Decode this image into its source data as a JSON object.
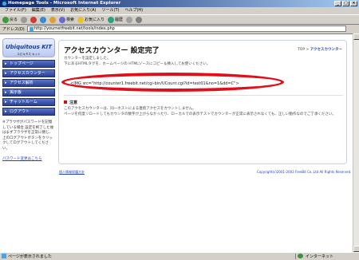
{
  "window": {
    "title": "Homepage Tools - Microsoft Internet Explorer"
  },
  "menu": [
    "ファイル(F)",
    "編集(E)",
    "表示(V)",
    "お気に入り(A)",
    "ツール(T)",
    "ヘルプ(H)"
  ],
  "toolbar": {
    "back": "戻る",
    "search": "検索",
    "favorites": "お気に入り",
    "history": "履歴"
  },
  "address": {
    "label": "アドレス(D)",
    "url": "http://yournetfreebit.net/tools/index.php"
  },
  "status": {
    "left": "ページが表示されました",
    "right": "インターネット"
  },
  "sidebar": {
    "logo": "Ubiquitous KIT",
    "logo_sub": "ユビキタス キット",
    "items": [
      "トップページ",
      "アクセスカウンター",
      "アクセス解析",
      "掲示板",
      "チャットルーム",
      "ログアウト"
    ],
    "note": "※ブラウザがパスワードを記憶している場合 設定を終了した後はまずブラウザを正常に閉じ、上のログアウトボタンをクリックしてログアウトしてください。",
    "link": "パスワード変更はこちら"
  },
  "main": {
    "title": "アクセスカウンター 設定完了",
    "breadcrumb_top": "TOP >",
    "breadcrumb_current": "アクセスカウンター",
    "intro1": "カウンターを設定しました。",
    "intro2": "下にあるHTMLタグを、ホームページの HTMLソースにコピー＆挿入してお使いください。",
    "code": "<IMG src=\"http://counter1.freebit.net/cgi-bin/UCount.cgi?id=test01&no=1&dd=C\">",
    "notice_title": "注意",
    "notice1": "このアクセスカウンターは、同一ホストによる連続アクセスをカウントしません。",
    "notice2": "ページを何度リロードしてもカウンタの数字が上がらなかったり、ローカルでの表示テストでカウンターが正常に表示されなくても、正しい動作なのでご了承ください。"
  },
  "footer": {
    "left": "個人情報保護方針",
    "right": "Copyright(c)2001-2003 FreeBit Co.,Ltd All Rights Reserved."
  }
}
